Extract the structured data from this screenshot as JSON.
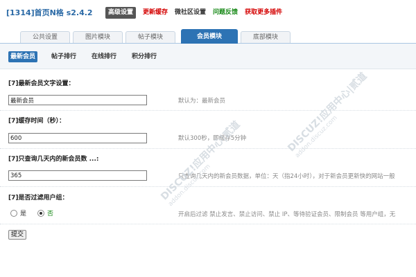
{
  "header": {
    "app_title": "[1314]首页N格 s2.4.2",
    "nav": [
      {
        "label": "高级设置"
      },
      {
        "label": "更新缓存"
      },
      {
        "label": "微社区设置"
      },
      {
        "label": "问题反馈"
      },
      {
        "label": "获取更多插件"
      }
    ]
  },
  "module_tabs": [
    {
      "label": "公共设置"
    },
    {
      "label": "图片模块"
    },
    {
      "label": "帖子模块"
    },
    {
      "label": "会员模块"
    },
    {
      "label": "底部模块"
    }
  ],
  "sub_tabs": [
    {
      "label": "最新会员"
    },
    {
      "label": "帖子排行"
    },
    {
      "label": "在线排行"
    },
    {
      "label": "积分排行"
    }
  ],
  "fields": [
    {
      "label": "[7]最新会员文字设置：",
      "value": "最新会员",
      "hint": "默认为：最新会员"
    },
    {
      "label": "[7]缓存时间（秒）：",
      "value": "600",
      "hint": "默认300秒，即缓存5分钟"
    },
    {
      "label": "[7]只查询几天内的新会员数 ...:",
      "value": "365",
      "hint": "只查询几天内的新会员数据，单位：天（指24小时），对于新会员更新快的网站一般"
    },
    {
      "label": "[7]是否过滤用户组：",
      "hint": "开启后过滤 禁止发言、禁止访问、禁止 IP、等待验证会员、限制会员 等用户组，无"
    }
  ],
  "filter_options": [
    {
      "label": "是",
      "checked": false
    },
    {
      "label": "否",
      "checked": true
    }
  ],
  "submit_label": "提交",
  "watermark": {
    "text": "DISCUZ!应用中心|贰道",
    "url": "addon.discuz.com"
  }
}
